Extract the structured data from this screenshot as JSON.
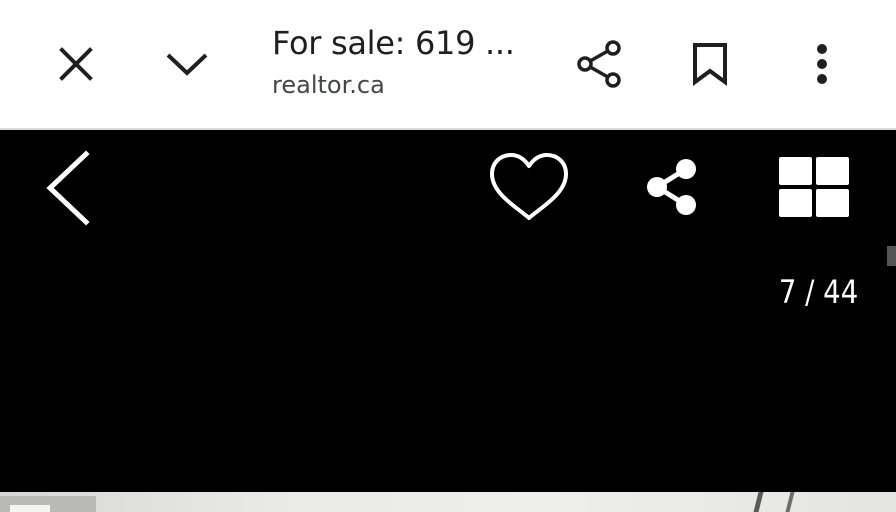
{
  "toolbar": {
    "title": "For sale: 619 ...",
    "domain": "realtor.ca",
    "icons": {
      "close": "close-icon",
      "minimize": "chevron-down-icon",
      "share": "share-icon",
      "bookmark": "bookmark-icon",
      "menu": "more-vert-icon"
    }
  },
  "gallery": {
    "counter": "7 / 44",
    "current_index": 7,
    "total": 44,
    "icons": {
      "back": "chevron-left-icon",
      "favorite": "heart-outline-icon",
      "share": "share-icon",
      "grid": "grid-view-icon"
    }
  },
  "colors": {
    "toolbar_bg": "#ffffff",
    "toolbar_text": "#1f1f1f",
    "toolbar_secondary_text": "#444746",
    "viewer_bg": "#000000",
    "viewer_icon": "#ffffff"
  }
}
